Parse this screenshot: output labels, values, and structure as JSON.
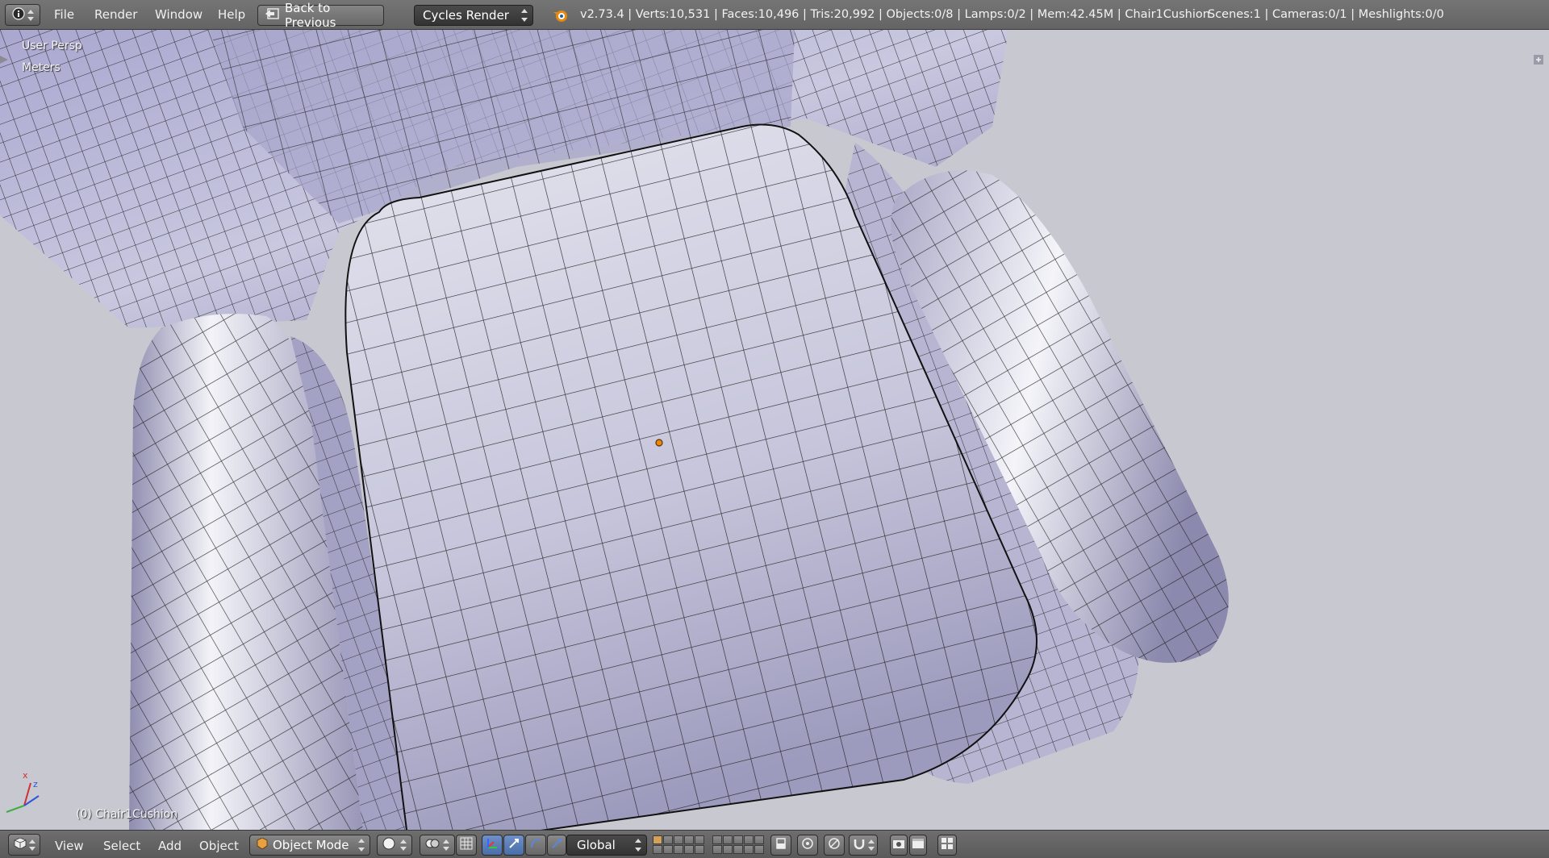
{
  "header": {
    "menus": [
      "File",
      "Render",
      "Window",
      "Help"
    ],
    "back_button": "Back to Previous",
    "render_engine": "Cycles Render",
    "stats": "v2.73.4 | Verts:10,531 | Faces:10,496 | Tris:20,992 | Objects:0/8 | Lamps:0/2 | Mem:42.45M | Chair1Cushion",
    "scene_stats": "Scenes:1 | Cameras:0/1 | Meshlights:0/0"
  },
  "viewport": {
    "view_name": "User Persp",
    "units": "Meters",
    "active_object": "(0) Chair1Cushion",
    "axis_labels": {
      "x": "x",
      "z": "z"
    },
    "background_color": "#c8c8d0"
  },
  "footer": {
    "menus": [
      "View",
      "Select",
      "Add",
      "Object"
    ],
    "mode": "Object Mode",
    "orientation": "Global"
  },
  "icons": {
    "editor_type": "info-icon",
    "blender_logo": "blender-logo-icon",
    "view3d_editor": "view3d-icon"
  },
  "colors": {
    "header_bg": "#6a6a6a",
    "select_dark": "#3a3a3a",
    "active_blue": "#5680c2",
    "origin_orange": "#e8890c"
  }
}
